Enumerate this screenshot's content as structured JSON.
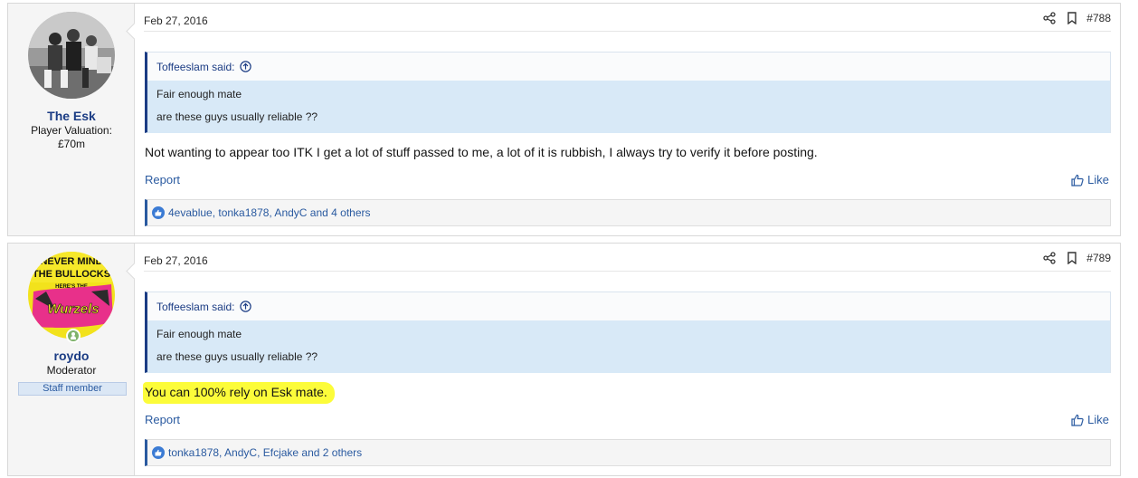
{
  "posts": [
    {
      "date": "Feb 27, 2016",
      "number": "#788",
      "user": {
        "name": "The Esk",
        "title_line1": "Player Valuation:",
        "title_line2": "£70m",
        "avatar": "black-and-white-photo-avatar"
      },
      "quote": {
        "author": "Toffeeslam said:",
        "line1": "Fair enough mate",
        "line2": "are these guys usually reliable ??"
      },
      "message": "Not wanting to appear too ITK I get a lot of stuff passed to me, a lot of it is rubbish, I always try to verify it before posting.",
      "report_label": "Report",
      "like_label": "Like",
      "reactions_text": "4evablue, tonka1878, AndyC and 4 others"
    },
    {
      "date": "Feb 27, 2016",
      "number": "#789",
      "user": {
        "name": "roydo",
        "title_line1": "Moderator",
        "badge": "Staff member",
        "avatar": "never-mind-the-bullocks-wurzels-avatar",
        "avatar_text_line1": "NEVER MIND",
        "avatar_text_line2": "THE BULLOCKS",
        "avatar_text_line3": "HERE'S THE",
        "avatar_text_line4": "Wurzels"
      },
      "quote": {
        "author": "Toffeeslam said:",
        "line1": "Fair enough mate",
        "line2": "are these guys usually reliable ??"
      },
      "message": "You can 100% rely on Esk mate.",
      "report_label": "Report",
      "like_label": "Like",
      "reactions_text": "tonka1878, AndyC, Efcjake and 2 others"
    }
  ],
  "colors": {
    "username": "#1b3c84",
    "link": "#2a5aa0",
    "quote_bg": "#d8e9f7",
    "highlight": "#fcfc3a",
    "user_col_bg": "#f5f5f5"
  }
}
